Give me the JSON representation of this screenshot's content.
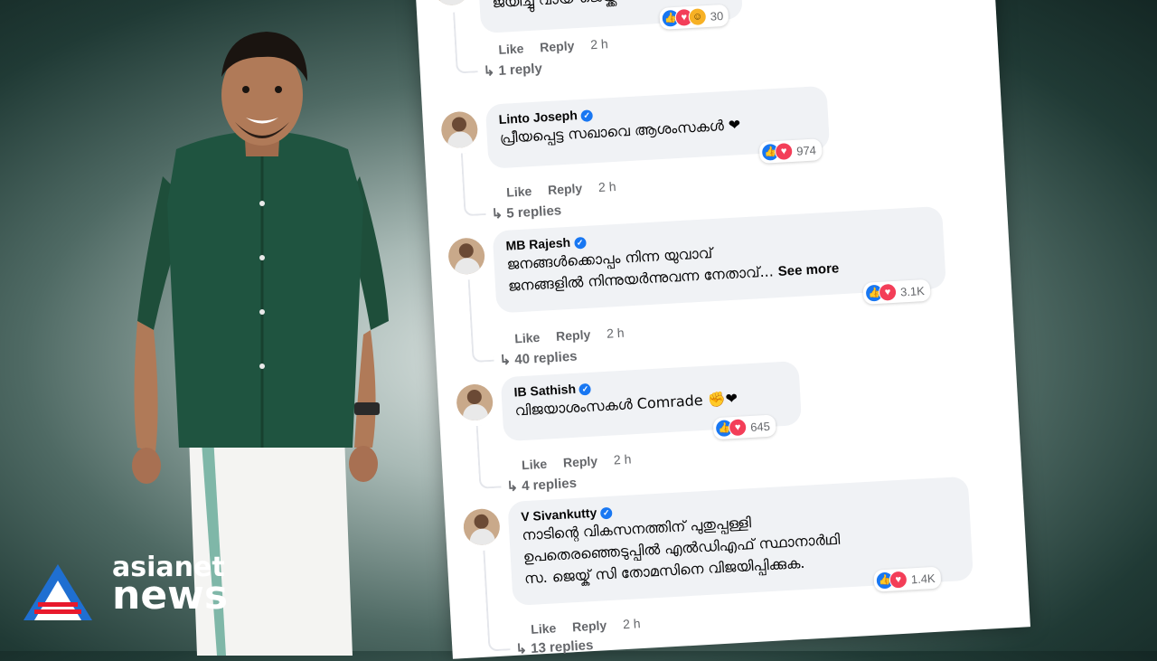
{
  "logo": {
    "line1": "asianet",
    "line2": "news"
  },
  "comments": [
    {
      "name": "",
      "text": "ജയിച്ചു വായ് ജെയ്ക്ക് ❤",
      "reactions": {
        "icons": [
          "like-icon",
          "love-icon",
          "haha-icon"
        ],
        "count": "30"
      },
      "actions": {
        "like": "Like",
        "reply": "Reply",
        "time": "2 h"
      },
      "replies": "1 reply"
    },
    {
      "name": "Linto Joseph",
      "text": "പ്രീയപ്പെട്ട സഖാവെ ആശംസകൾ ❤",
      "reactions": {
        "icons": [
          "like-icon",
          "love-icon"
        ],
        "count": "974"
      },
      "actions": {
        "like": "Like",
        "reply": "Reply",
        "time": "2 h"
      },
      "replies": "5 replies"
    },
    {
      "name": "MB Rajesh",
      "text_line1": "ജനങ്ങൾക്കൊപ്പം നിന്ന യുവാവ്",
      "text_line2": "ജനങ്ങളിൽ നിന്നുയർന്നുവന്ന നേതാവ്...",
      "see_more": "See more",
      "reactions": {
        "icons": [
          "like-icon",
          "love-icon"
        ],
        "count": "3.1K"
      },
      "actions": {
        "like": "Like",
        "reply": "Reply",
        "time": "2 h"
      },
      "replies": "40 replies"
    },
    {
      "name": "IB Sathish",
      "text": "വിജയാശംസകൾ Comrade ✊❤",
      "reactions": {
        "icons": [
          "like-icon",
          "love-icon"
        ],
        "count": "645"
      },
      "actions": {
        "like": "Like",
        "reply": "Reply",
        "time": "2 h"
      },
      "replies": "4 replies"
    },
    {
      "name": "V Sivankutty",
      "text_line1": "നാടിന്റെ വികസനത്തിന് പുതുപ്പള്ളി",
      "text_line2": "ഉപതെരഞ്ഞെടുപ്പിൽ എൽഡിഎഫ് സ്ഥാനാർഥി",
      "text_line3": "സ. ജെയ്ക് സി തോമസിനെ വിജയിപ്പിക്കുക.",
      "reactions": {
        "icons": [
          "like-icon",
          "love-icon"
        ],
        "count": "1.4K"
      },
      "actions": {
        "like": "Like",
        "reply": "Reply",
        "time": "2 h"
      },
      "replies": "13 replies"
    }
  ],
  "colors": {
    "brand_blue": "#1877f2",
    "love_red": "#f33e58",
    "text_gray": "#65676b",
    "bubble_bg": "#f0f2f5",
    "logo_blue": "#1f6fd1",
    "logo_red": "#e8192c"
  }
}
